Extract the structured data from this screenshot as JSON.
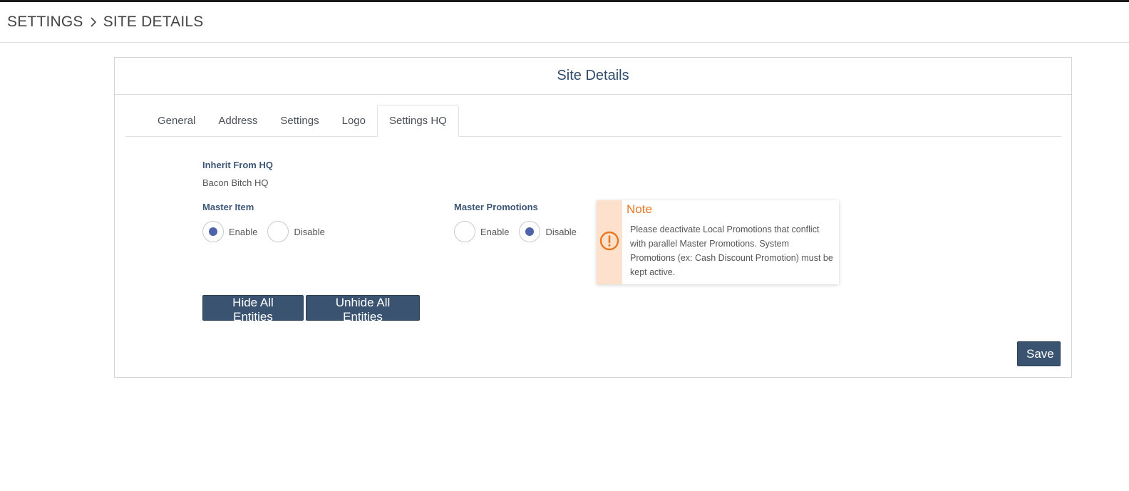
{
  "breadcrumb": {
    "root": "SETTINGS",
    "current": "SITE DETAILS"
  },
  "card": {
    "title": "Site Details"
  },
  "tabs": [
    {
      "label": "General",
      "active": false
    },
    {
      "label": "Address",
      "active": false
    },
    {
      "label": "Settings",
      "active": false
    },
    {
      "label": "Logo",
      "active": false
    },
    {
      "label": "Settings HQ",
      "active": true
    }
  ],
  "inherit": {
    "label": "Inherit From HQ",
    "value": "Bacon Bitch HQ"
  },
  "master_item": {
    "label": "Master Item",
    "options": [
      {
        "label": "Enable",
        "checked": true
      },
      {
        "label": "Disable",
        "checked": false
      }
    ]
  },
  "master_promotions": {
    "label": "Master Promotions",
    "options": [
      {
        "label": "Enable",
        "checked": false
      },
      {
        "label": "Disable",
        "checked": true
      }
    ]
  },
  "note": {
    "title": "Note",
    "text": "Please deactivate Local Promotions that conflict with parallel Master Promotions. System Promotions (ex: Cash Discount Promotion) must be kept active.",
    "icon": "exclamation-circle-icon",
    "accent_color": "#e87722",
    "side_color": "#fde1cc"
  },
  "buttons": {
    "hide_all": "Hide All Entities",
    "unhide_all": "Unhide All Entities",
    "save": "Save"
  },
  "colors": {
    "primary": "#3a5370",
    "radio_checked": "#4e63a8",
    "title": "#2f4a6a"
  }
}
